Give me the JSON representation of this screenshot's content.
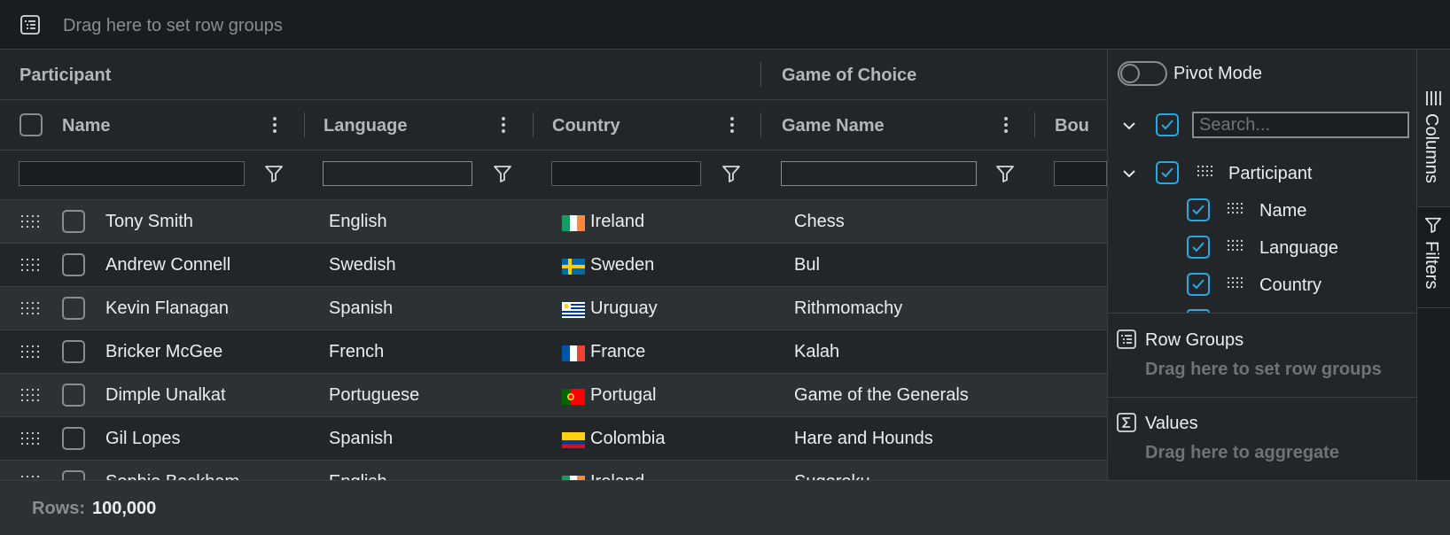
{
  "row_group_bar": {
    "placeholder": "Drag here to set row groups"
  },
  "header": {
    "groups": [
      "Participant",
      "Game of Choice"
    ],
    "columns": [
      "Name",
      "Language",
      "Country",
      "Game Name",
      "Bou"
    ]
  },
  "rows": [
    {
      "name": "Tony Smith",
      "language": "English",
      "country": "Ireland",
      "flag": "ie",
      "game": "Chess"
    },
    {
      "name": "Andrew Connell",
      "language": "Swedish",
      "country": "Sweden",
      "flag": "se",
      "game": "Bul"
    },
    {
      "name": "Kevin Flanagan",
      "language": "Spanish",
      "country": "Uruguay",
      "flag": "uy",
      "game": "Rithmomachy"
    },
    {
      "name": "Bricker McGee",
      "language": "French",
      "country": "France",
      "flag": "fr",
      "game": "Kalah"
    },
    {
      "name": "Dimple Unalkat",
      "language": "Portuguese",
      "country": "Portugal",
      "flag": "pt",
      "game": "Game of the Generals"
    },
    {
      "name": "Gil Lopes",
      "language": "Spanish",
      "country": "Colombia",
      "flag": "co",
      "game": "Hare and Hounds"
    },
    {
      "name": "Sophie Beckham",
      "language": "English",
      "country": "Ireland",
      "flag": "ie",
      "game": "Sugoroku"
    }
  ],
  "tool_panel": {
    "pivot_mode": "Pivot Mode",
    "search_placeholder": "Search...",
    "column_group": "Participant",
    "columns": [
      "Name",
      "Language",
      "Country"
    ],
    "row_groups_title": "Row Groups",
    "row_groups_hint": "Drag here to set row groups",
    "values_title": "Values",
    "values_hint": "Drag here to aggregate"
  },
  "side_bar": {
    "columns_tab": "Columns",
    "filters_tab": "Filters"
  },
  "status_bar": {
    "rows_label": "Rows:",
    "rows_value": "100,000"
  },
  "colors": {
    "accent": "#2aa8e0",
    "background": "#181d1f",
    "header": "#222628",
    "row_alt": "#2c3234"
  }
}
